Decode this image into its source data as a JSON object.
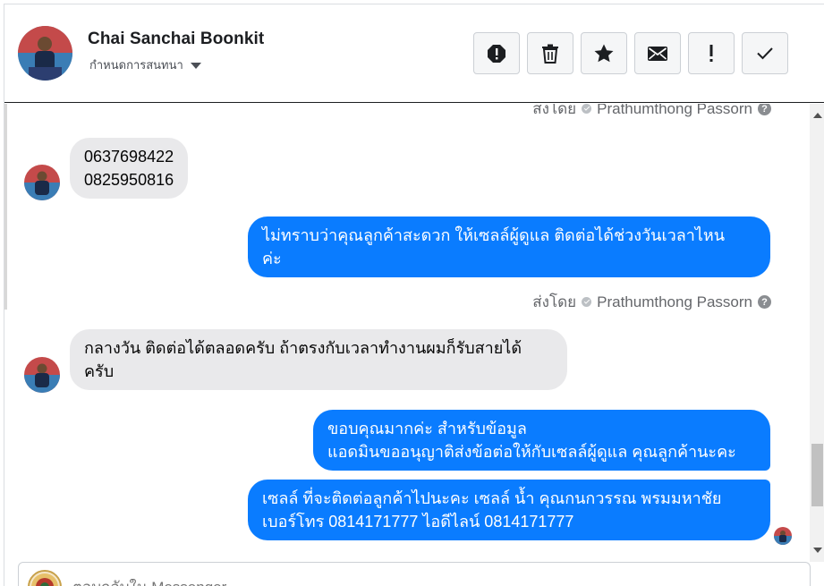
{
  "header": {
    "contact_name": "Chai Sanchai Boonkit",
    "assign_label": "กำหนดการสนทนา",
    "actions": [
      {
        "icon": "alert-octagon-icon",
        "name": "spam"
      },
      {
        "icon": "trash-icon",
        "name": "delete"
      },
      {
        "icon": "star-icon",
        "name": "star"
      },
      {
        "icon": "envelope-icon",
        "name": "mark-unread"
      },
      {
        "icon": "exclamation-icon",
        "name": "follow-up"
      },
      {
        "icon": "check-icon",
        "name": "done"
      }
    ]
  },
  "messages": {
    "top_sentby_prefix": "ส่งโดย",
    "top_sentby_name": "Prathumthong Passorn",
    "m1_text": "0637698422\n0825950816",
    "m2_text": "ไม่ทราบว่าคุณลูกค้าสะดวก ให้เซลล์ผู้ดูแล ติดต่อได้ช่วงวันเวลาไหน\nค่ะ",
    "m2_sentby_prefix": "ส่งโดย",
    "m2_sentby_name": "Prathumthong Passorn",
    "m3_text": "กลางวัน ติดต่อได้ตลอดครับ ถ้าตรงกับเวลาทำงานผมก็รับสายได้\nครับ",
    "m4_text": "ขอบคุณมากค่ะ สำหรับข้อมูล\nแอดมินขออนุญาติส่งข้อต่อให้กับเซลล์ผู้ดูแล คุณลูกค้านะคะ",
    "m5_text": "เซลล์ ที่จะติดต่อลูกค้าไปนะคะ เซลล์ น้ำ คุณกนกวรรณ พรมมหาชัย\nเบอร์โทร 0814171777 ไอดีไลน์ 0814171777"
  },
  "composer": {
    "placeholder": "ตอบกลับใน Messenger"
  },
  "colors": {
    "outgoing_bubble": "#0a7cff",
    "incoming_bubble": "#e9e9eb"
  }
}
